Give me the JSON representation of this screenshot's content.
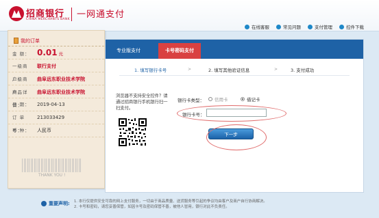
{
  "header": {
    "brand_cn": "招商银行",
    "brand_en": "CHINA MERCHANTS BANK",
    "service_title": "一网通支付",
    "links": [
      {
        "label": "在线客服",
        "icon": "headset-icon"
      },
      {
        "label": "常见问题",
        "icon": "question-icon"
      },
      {
        "label": "支付管理",
        "icon": "wallet-icon"
      },
      {
        "label": "控件下载",
        "icon": "download-icon"
      }
    ]
  },
  "receipt": {
    "title": "我的订单",
    "rows": [
      {
        "label": "金    额：",
        "value": "0.01",
        "unit": "元"
      },
      {
        "label": "一级商户：",
        "value": "联行支付"
      },
      {
        "label": "二级商户：",
        "value": "曲阜远东职业技术学院"
      },
      {
        "label": "商品详情：",
        "value": "曲阜远东职业技术学院"
      },
      {
        "label": "日    期：",
        "value": "2019-04-13"
      },
      {
        "label": "订 单 号：",
        "value": "213033429"
      },
      {
        "label": "币    种：",
        "value": "人民币"
      }
    ],
    "thanks": "THANK YOU !"
  },
  "panel": {
    "tabs": [
      "专业版支付",
      "卡号密码支付"
    ],
    "active_tab": 1,
    "steps": [
      "1. 填写银行卡号",
      "2. 填写其他验证信息",
      "3. 支付成功"
    ],
    "note": "浏览器不支持安全控件？请通过招商银行手机银行扫一扫支付。",
    "card_type_label": "银行卡类型：",
    "card_types": [
      "信用卡",
      "借记卡"
    ],
    "card_type_selected": "借记卡",
    "card_no_label": "银行卡号：",
    "card_no_value": "",
    "next_label": "下一步"
  },
  "notice": {
    "label": "重要声明:",
    "lines": [
      "1. 本行仅提供安全可靠的网上支付服务，一切由于商品质量、送货服务等引起的争议均由客户及商户自行协商解决。",
      "2. 卡号和密码，请您妥善保管，如因卡号及密码保管不善，被他人冒用，银行对此不负责任。"
    ]
  },
  "colors": {
    "brand_red": "#c8102e",
    "brand_blue": "#1e62a6",
    "tab_red": "#d94141"
  }
}
